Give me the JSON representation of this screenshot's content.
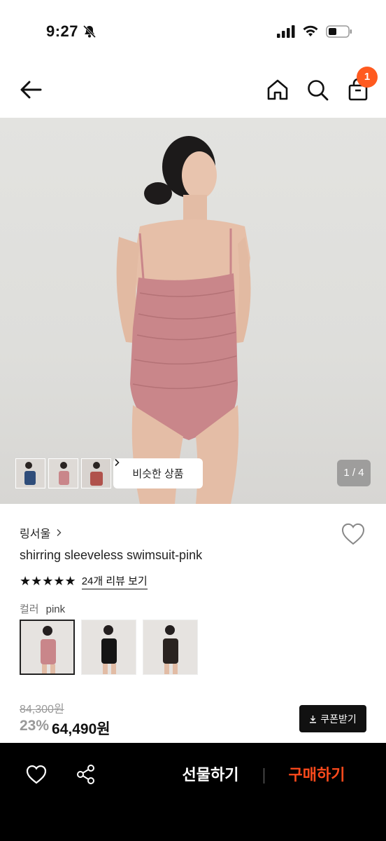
{
  "status_bar": {
    "time": "9:27"
  },
  "header": {
    "cart_count": "1"
  },
  "gallery": {
    "similar_button_label": "비슷한 상품",
    "page_indicator": "1 / 4"
  },
  "product": {
    "brand": "링서울",
    "name": "shirring sleeveless swimsuit-pink",
    "rating_stars": "★★★★★",
    "review_link": "24개 리뷰 보기",
    "color_label": "컬러",
    "color_value": "pink",
    "original_price": "84,300원",
    "discount_rate": "23%",
    "sale_price": "64,490원",
    "coupon_label": "쿠폰받기"
  },
  "bottom_bar": {
    "gift_label": "선물하기",
    "buy_label": "구매하기"
  },
  "colors": {
    "accent": "#ff5a1f",
    "buy": "#ff4a1c",
    "swimsuit_pink": "#c9868a"
  }
}
